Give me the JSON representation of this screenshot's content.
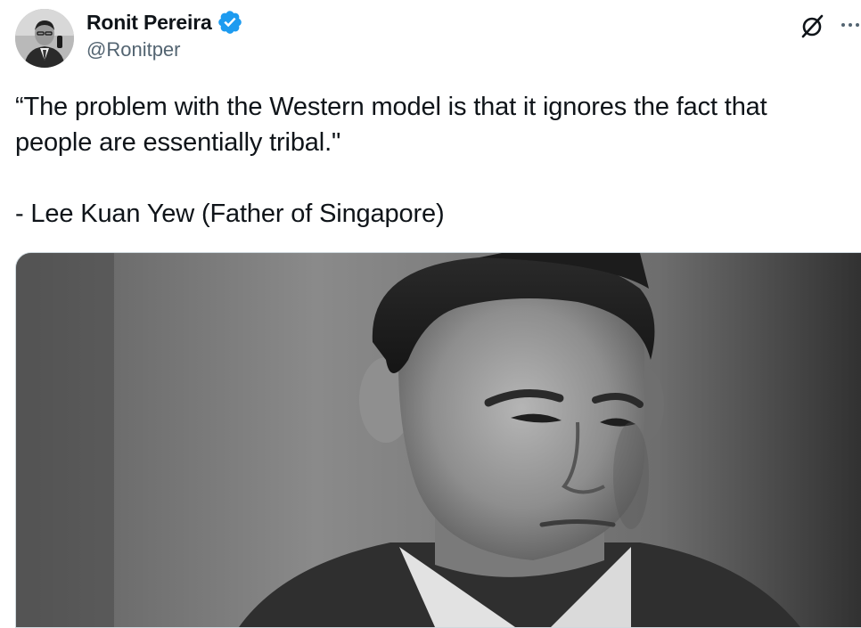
{
  "author": {
    "display_name": "Ronit Pereira",
    "handle": "@Ronitper",
    "verified": true,
    "verified_color": "#1d9bf0",
    "avatar_icon": "avatar-photo"
  },
  "actions": {
    "grok_icon": "grok-icon",
    "more_icon": "more-dots-icon"
  },
  "tweet": {
    "quote": "“The problem with the Western model is that it ignores the fact that people are essentially tribal.\"",
    "attribution": "- Lee Kuan Yew (Father of Singapore)"
  },
  "media": {
    "type": "photo",
    "style": "black-and-white portrait"
  },
  "colors": {
    "text": "#0f1419",
    "secondary": "#536471",
    "border": "#cfd9de"
  }
}
